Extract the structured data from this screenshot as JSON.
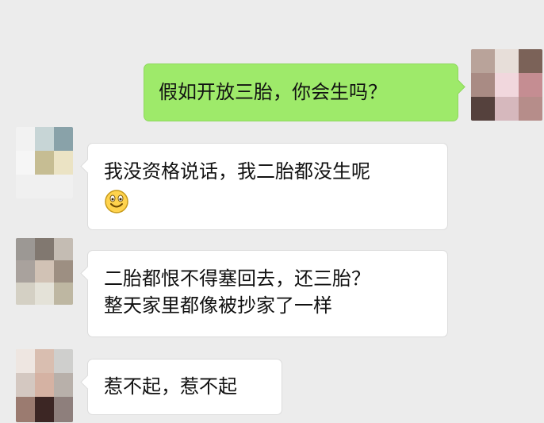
{
  "messages": [
    {
      "side": "out",
      "text": "假如开放三胎，你会生吗？"
    },
    {
      "side": "in",
      "text": "我没资格说话，我二胎都没生呢",
      "emoji": "smiley-face-emoji"
    },
    {
      "side": "in",
      "text": "二胎都恨不得塞回去，还三胎？\n整天家里都像被抄家了一样"
    },
    {
      "side": "in",
      "text": "惹不起，惹不起"
    }
  ],
  "colors": {
    "background": "#ececec",
    "outgoing_bubble": "#9eea6a",
    "incoming_bubble": "#ffffff"
  }
}
